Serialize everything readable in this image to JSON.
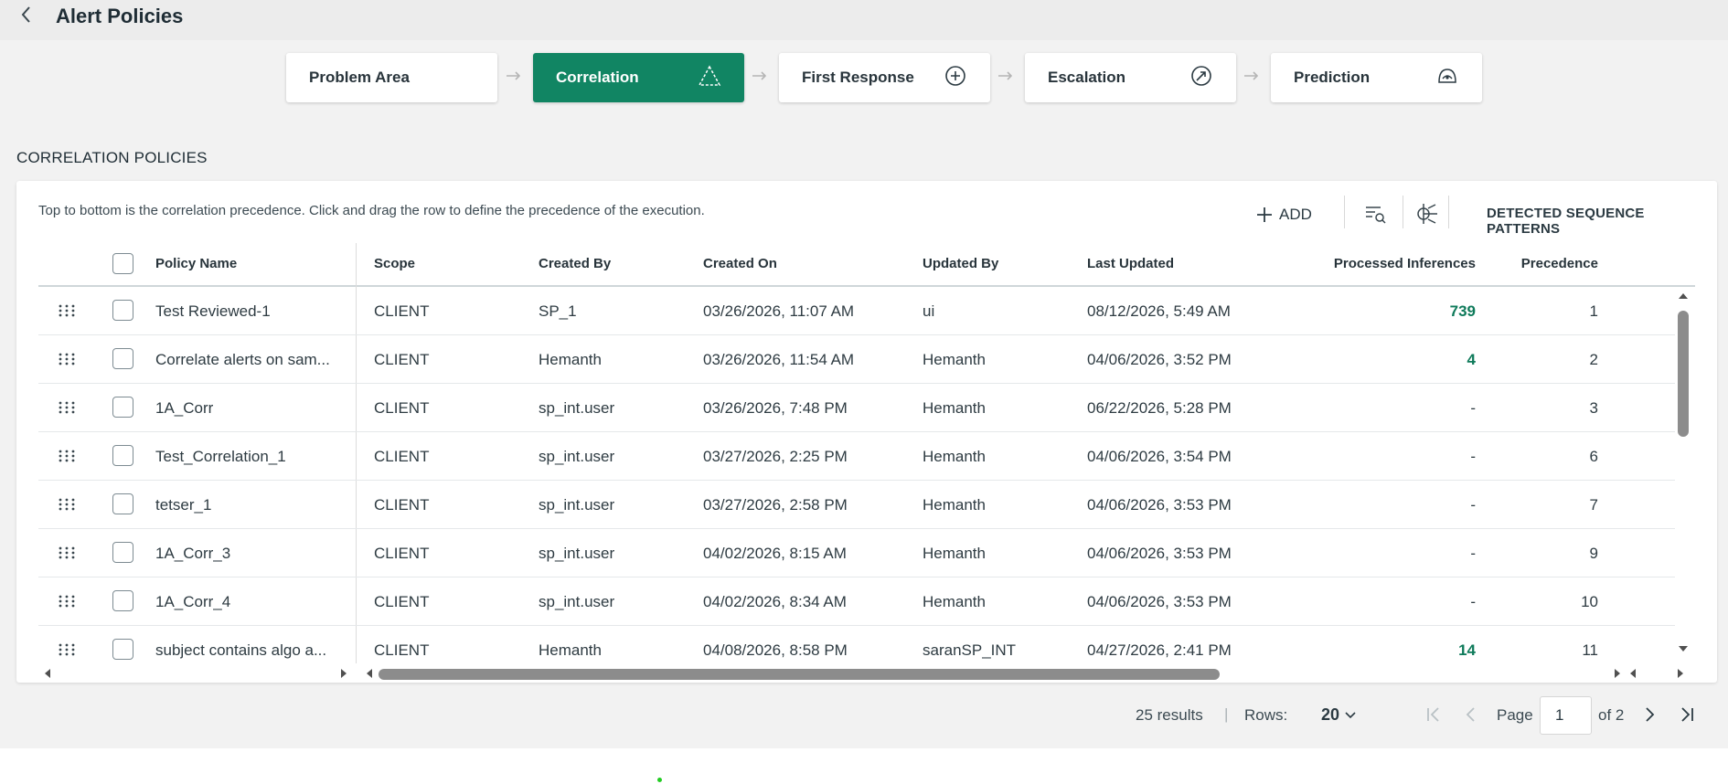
{
  "header": {
    "title": "Alert Policies"
  },
  "stepper": {
    "steps": [
      {
        "label": "Problem Area",
        "icon": "",
        "active": false
      },
      {
        "label": "Correlation",
        "icon": "triangle-icon",
        "active": true
      },
      {
        "label": "First Response",
        "icon": "plus-circle-icon",
        "active": false
      },
      {
        "label": "Escalation",
        "icon": "escalation-arrow-icon",
        "active": false
      },
      {
        "label": "Prediction",
        "icon": "prediction-icon",
        "active": false
      }
    ]
  },
  "section": {
    "title": "CORRELATION POLICIES",
    "hint": "Top to bottom is the correlation precedence. Click and drag the row to define the precedence of the execution."
  },
  "toolbar": {
    "add_label": "ADD",
    "detected_label": "DETECTED SEQUENCE PATTERNS"
  },
  "table": {
    "columns": {
      "policy_name": "Policy Name",
      "scope": "Scope",
      "created_by": "Created By",
      "created_on": "Created On",
      "updated_by": "Updated By",
      "last_updated": "Last Updated",
      "processed": "Processed Inferences",
      "precedence": "Precedence"
    },
    "rows": [
      {
        "name": "Test Reviewed-1",
        "scope": "CLIENT",
        "created_by": "SP_1",
        "created_on": "03/26/2026, 11:07 AM",
        "updated_by": "ui",
        "last_updated": "08/12/2026, 5:49 AM",
        "processed": "739",
        "precedence": "1"
      },
      {
        "name": "Correlate alerts on sam...",
        "scope": "CLIENT",
        "created_by": "Hemanth",
        "created_on": "03/26/2026, 11:54 AM",
        "updated_by": "Hemanth",
        "last_updated": "04/06/2026, 3:52 PM",
        "processed": "4",
        "precedence": "2"
      },
      {
        "name": "1A_Corr",
        "scope": "CLIENT",
        "created_by": "sp_int.user",
        "created_on": "03/26/2026, 7:48 PM",
        "updated_by": "Hemanth",
        "last_updated": "06/22/2026, 5:28 PM",
        "processed": "-",
        "precedence": "3"
      },
      {
        "name": "Test_Correlation_1",
        "scope": "CLIENT",
        "created_by": "sp_int.user",
        "created_on": "03/27/2026, 2:25 PM",
        "updated_by": "Hemanth",
        "last_updated": "04/06/2026, 3:54 PM",
        "processed": "-",
        "precedence": "6"
      },
      {
        "name": "tetser_1",
        "scope": "CLIENT",
        "created_by": "sp_int.user",
        "created_on": "03/27/2026, 2:58 PM",
        "updated_by": "Hemanth",
        "last_updated": "04/06/2026, 3:53 PM",
        "processed": "-",
        "precedence": "7"
      },
      {
        "name": "1A_Corr_3",
        "scope": "CLIENT",
        "created_by": "sp_int.user",
        "created_on": "04/02/2026, 8:15 AM",
        "updated_by": "Hemanth",
        "last_updated": "04/06/2026, 3:53 PM",
        "processed": "-",
        "precedence": "9"
      },
      {
        "name": "1A_Corr_4",
        "scope": "CLIENT",
        "created_by": "sp_int.user",
        "created_on": "04/02/2026, 8:34 AM",
        "updated_by": "Hemanth",
        "last_updated": "04/06/2026, 3:53 PM",
        "processed": "-",
        "precedence": "10"
      },
      {
        "name": "subject contains algo a...",
        "scope": "CLIENT",
        "created_by": "Hemanth",
        "created_on": "04/08/2026, 8:58 PM",
        "updated_by": "saranSP_INT",
        "last_updated": "04/27/2026, 2:41 PM",
        "processed": "14",
        "precedence": "11"
      }
    ]
  },
  "pagination": {
    "results": "25 results",
    "separator": "|",
    "rows_label": "Rows:",
    "rows_value": "20",
    "page_label": "Page",
    "page_value": "1",
    "of_label": "of 2"
  },
  "colors": {
    "accent": "#118563",
    "processed_positive": "#0e7a5a"
  }
}
